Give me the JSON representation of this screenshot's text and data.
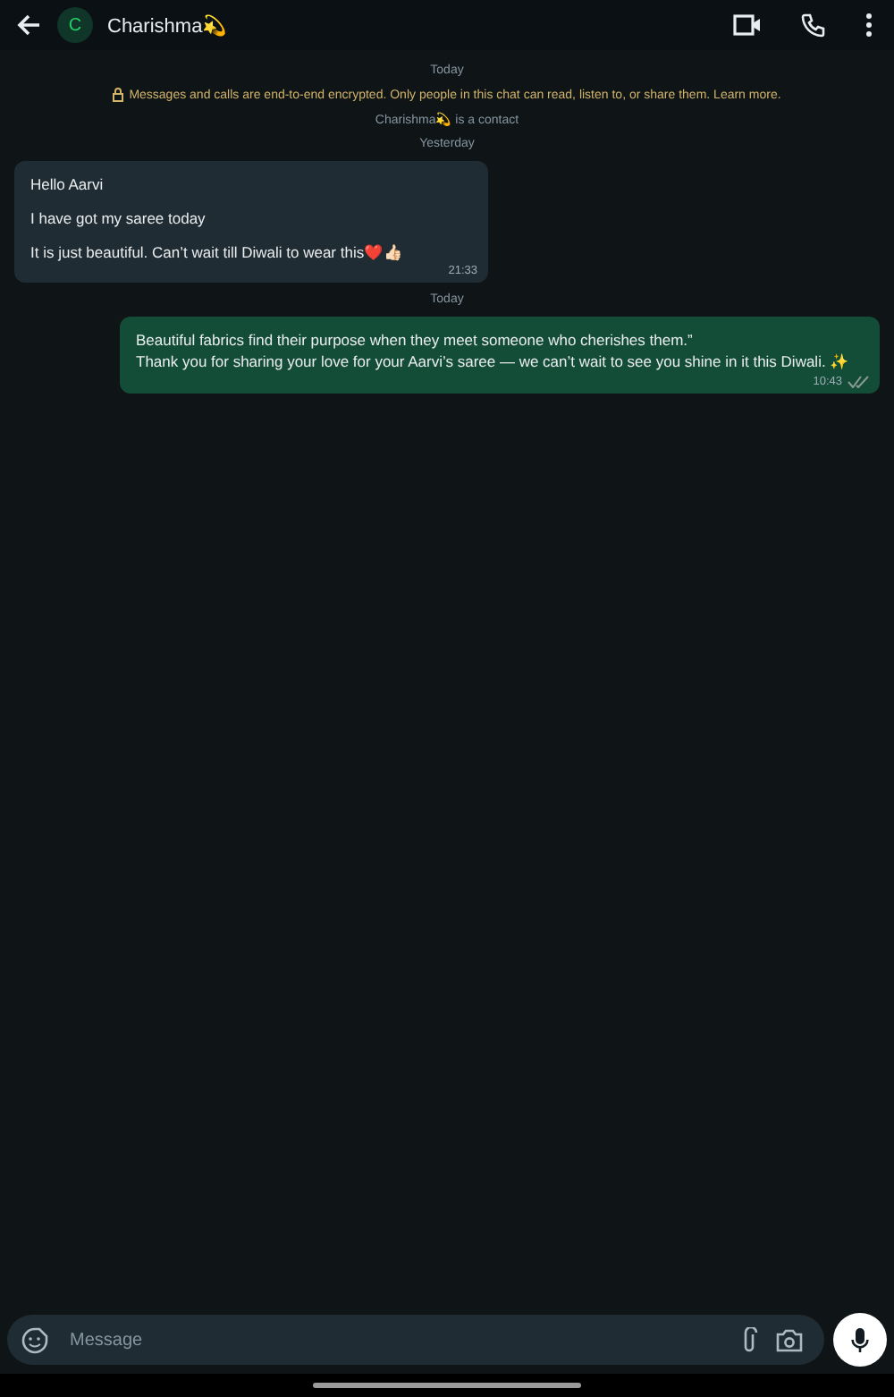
{
  "header": {
    "avatar_letter": "C",
    "contact_name": "Charishma💫"
  },
  "items": [
    {
      "kind": "date",
      "text": "Today"
    },
    {
      "kind": "notice",
      "text": "Messages and calls are end-to-end encrypted. Only people in this chat can read, listen to, or share them.",
      "link": "Learn more."
    },
    {
      "kind": "info",
      "text": "Charishma💫 is a contact"
    },
    {
      "kind": "date",
      "text": "Yesterday"
    },
    {
      "kind": "incoming",
      "lines": [
        "Hello Aarvi",
        "I have got my saree today",
        "It is just beautiful. Can’t wait till Diwali to wear this❤️👍🏻"
      ],
      "time": "21:33"
    },
    {
      "kind": "date",
      "text": "Today"
    },
    {
      "kind": "outgoing",
      "lines": [
        "Beautiful fabrics find their purpose when they meet someone who cherishes them.”\nThank you for sharing your love for your Aarvi’s saree — we can’t wait to see you shine in it this Diwali. ✨"
      ],
      "time": "10:43",
      "read": false
    }
  ],
  "composer": {
    "placeholder": "Message"
  }
}
